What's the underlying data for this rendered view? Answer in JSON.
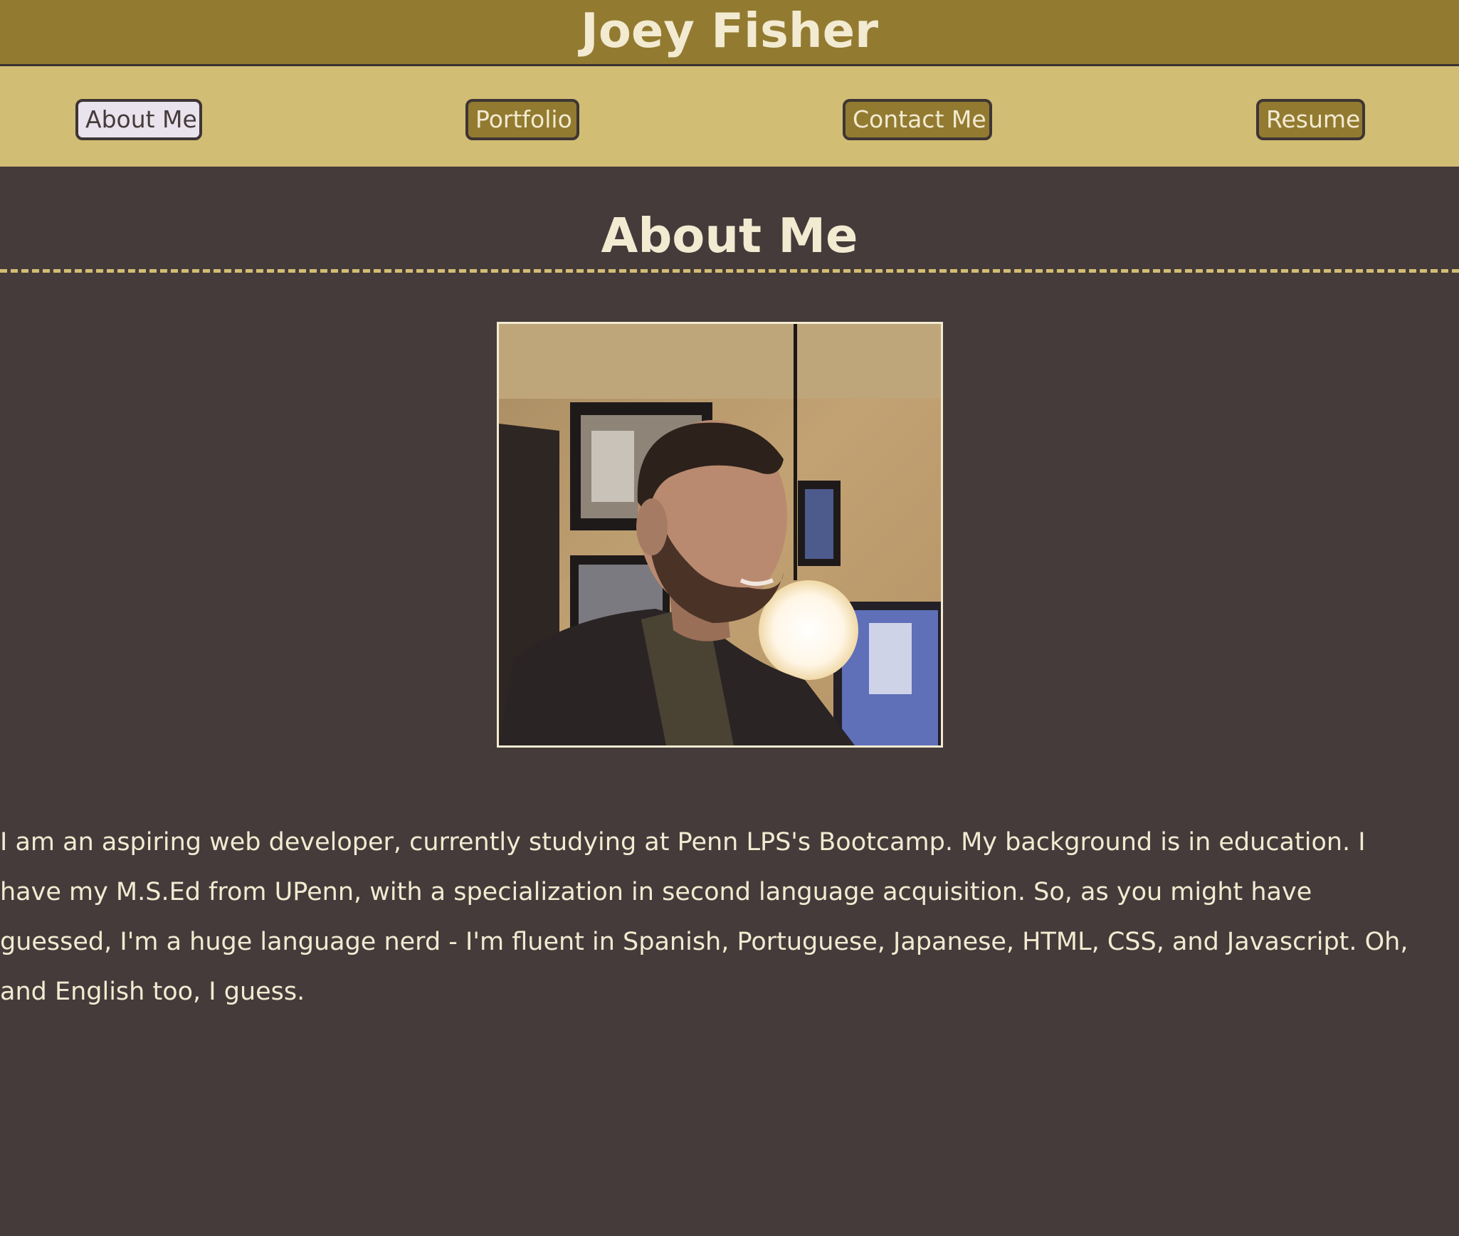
{
  "header": {
    "title": "Joey Fisher"
  },
  "nav": {
    "items": [
      {
        "label": "About Me",
        "active": true
      },
      {
        "label": "Portfolio",
        "active": false
      },
      {
        "label": "Contact Me",
        "active": false
      },
      {
        "label": "Resume",
        "active": false
      }
    ]
  },
  "main": {
    "section_title": "About Me",
    "photo_alt": "Joey Fisher",
    "bio": "I am an aspiring web developer, currently studying at Penn LPS's Bootcamp. My background is in education. I have my M.S.Ed from UPenn, with a specialization in second language acquisition. So, as you might have guessed, I'm a huge language nerd - I'm fluent in Spanish, Portuguese, Japanese, HTML, CSS, and Javascript. Oh, and English too, I guess."
  },
  "colors": {
    "header_bg": "#927b30",
    "nav_bg": "#d2bd74",
    "page_bg": "#453b3a",
    "text": "#f3ead2",
    "active_button_bg": "#e9e3ee"
  }
}
